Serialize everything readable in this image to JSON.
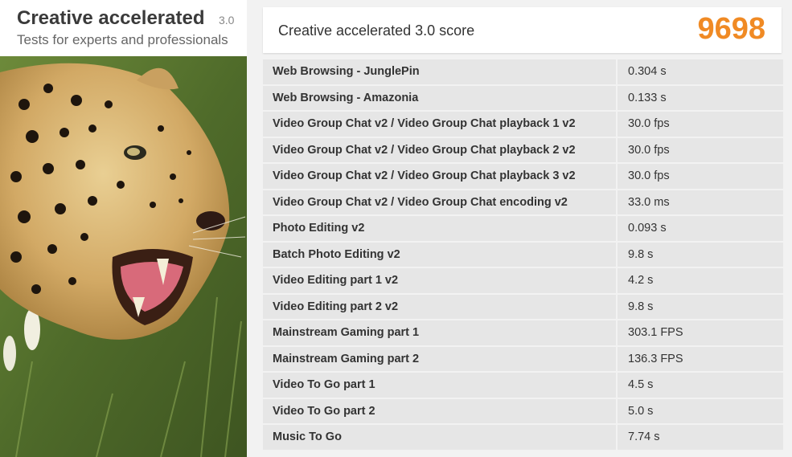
{
  "header": {
    "title": "Creative accelerated",
    "version": "3.0",
    "subtitle": "Tests for experts and professionals"
  },
  "score": {
    "label": "Creative accelerated 3.0 score",
    "value": "9698",
    "color": "#f08a24"
  },
  "results": [
    {
      "name": "Web Browsing - JunglePin",
      "value": "0.304 s"
    },
    {
      "name": "Web Browsing - Amazonia",
      "value": "0.133 s"
    },
    {
      "name": "Video Group Chat v2 / Video Group Chat playback 1 v2",
      "value": "30.0 fps"
    },
    {
      "name": "Video Group Chat v2 / Video Group Chat playback 2 v2",
      "value": "30.0 fps"
    },
    {
      "name": "Video Group Chat v2 / Video Group Chat playback 3 v2",
      "value": "30.0 fps"
    },
    {
      "name": "Video Group Chat v2 / Video Group Chat encoding v2",
      "value": "33.0 ms"
    },
    {
      "name": "Photo Editing v2",
      "value": "0.093 s"
    },
    {
      "name": "Batch Photo Editing v2",
      "value": "9.8 s"
    },
    {
      "name": "Video Editing part 1 v2",
      "value": "4.2 s"
    },
    {
      "name": "Video Editing part 2 v2",
      "value": "9.8 s"
    },
    {
      "name": "Mainstream Gaming part 1",
      "value": "303.1 FPS"
    },
    {
      "name": "Mainstream Gaming part 2",
      "value": "136.3 FPS"
    },
    {
      "name": "Video To Go part 1",
      "value": "4.5 s"
    },
    {
      "name": "Video To Go part 2",
      "value": "5.0 s"
    },
    {
      "name": "Music To Go",
      "value": "7.74 s"
    }
  ]
}
